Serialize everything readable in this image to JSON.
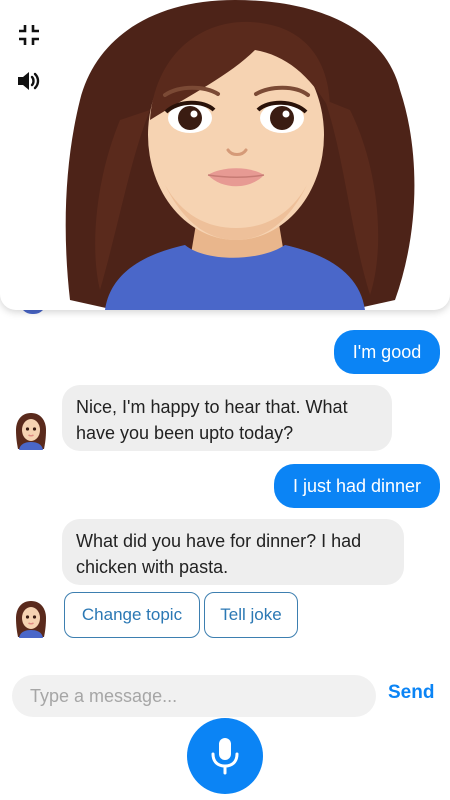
{
  "header": {
    "minimize_icon": "collapse-icon",
    "sound_icon": "speaker-icon"
  },
  "messages": [
    {
      "sender": "user",
      "text": "I'm good"
    },
    {
      "sender": "bot",
      "text": "Nice, I'm happy to hear that. What have you been upto today?"
    },
    {
      "sender": "user",
      "text": "I just had dinner"
    },
    {
      "sender": "bot",
      "text": "What did you have for dinner? I had chicken with pasta."
    }
  ],
  "quick_replies": [
    "Change topic",
    "Tell joke"
  ],
  "composer": {
    "placeholder": "Type a message...",
    "send_label": "Send",
    "mic_icon": "microphone-icon"
  },
  "colors": {
    "accent": "#0b84f5",
    "bot_bubble": "#eeeeee",
    "chip_border": "#3d7fb0"
  }
}
